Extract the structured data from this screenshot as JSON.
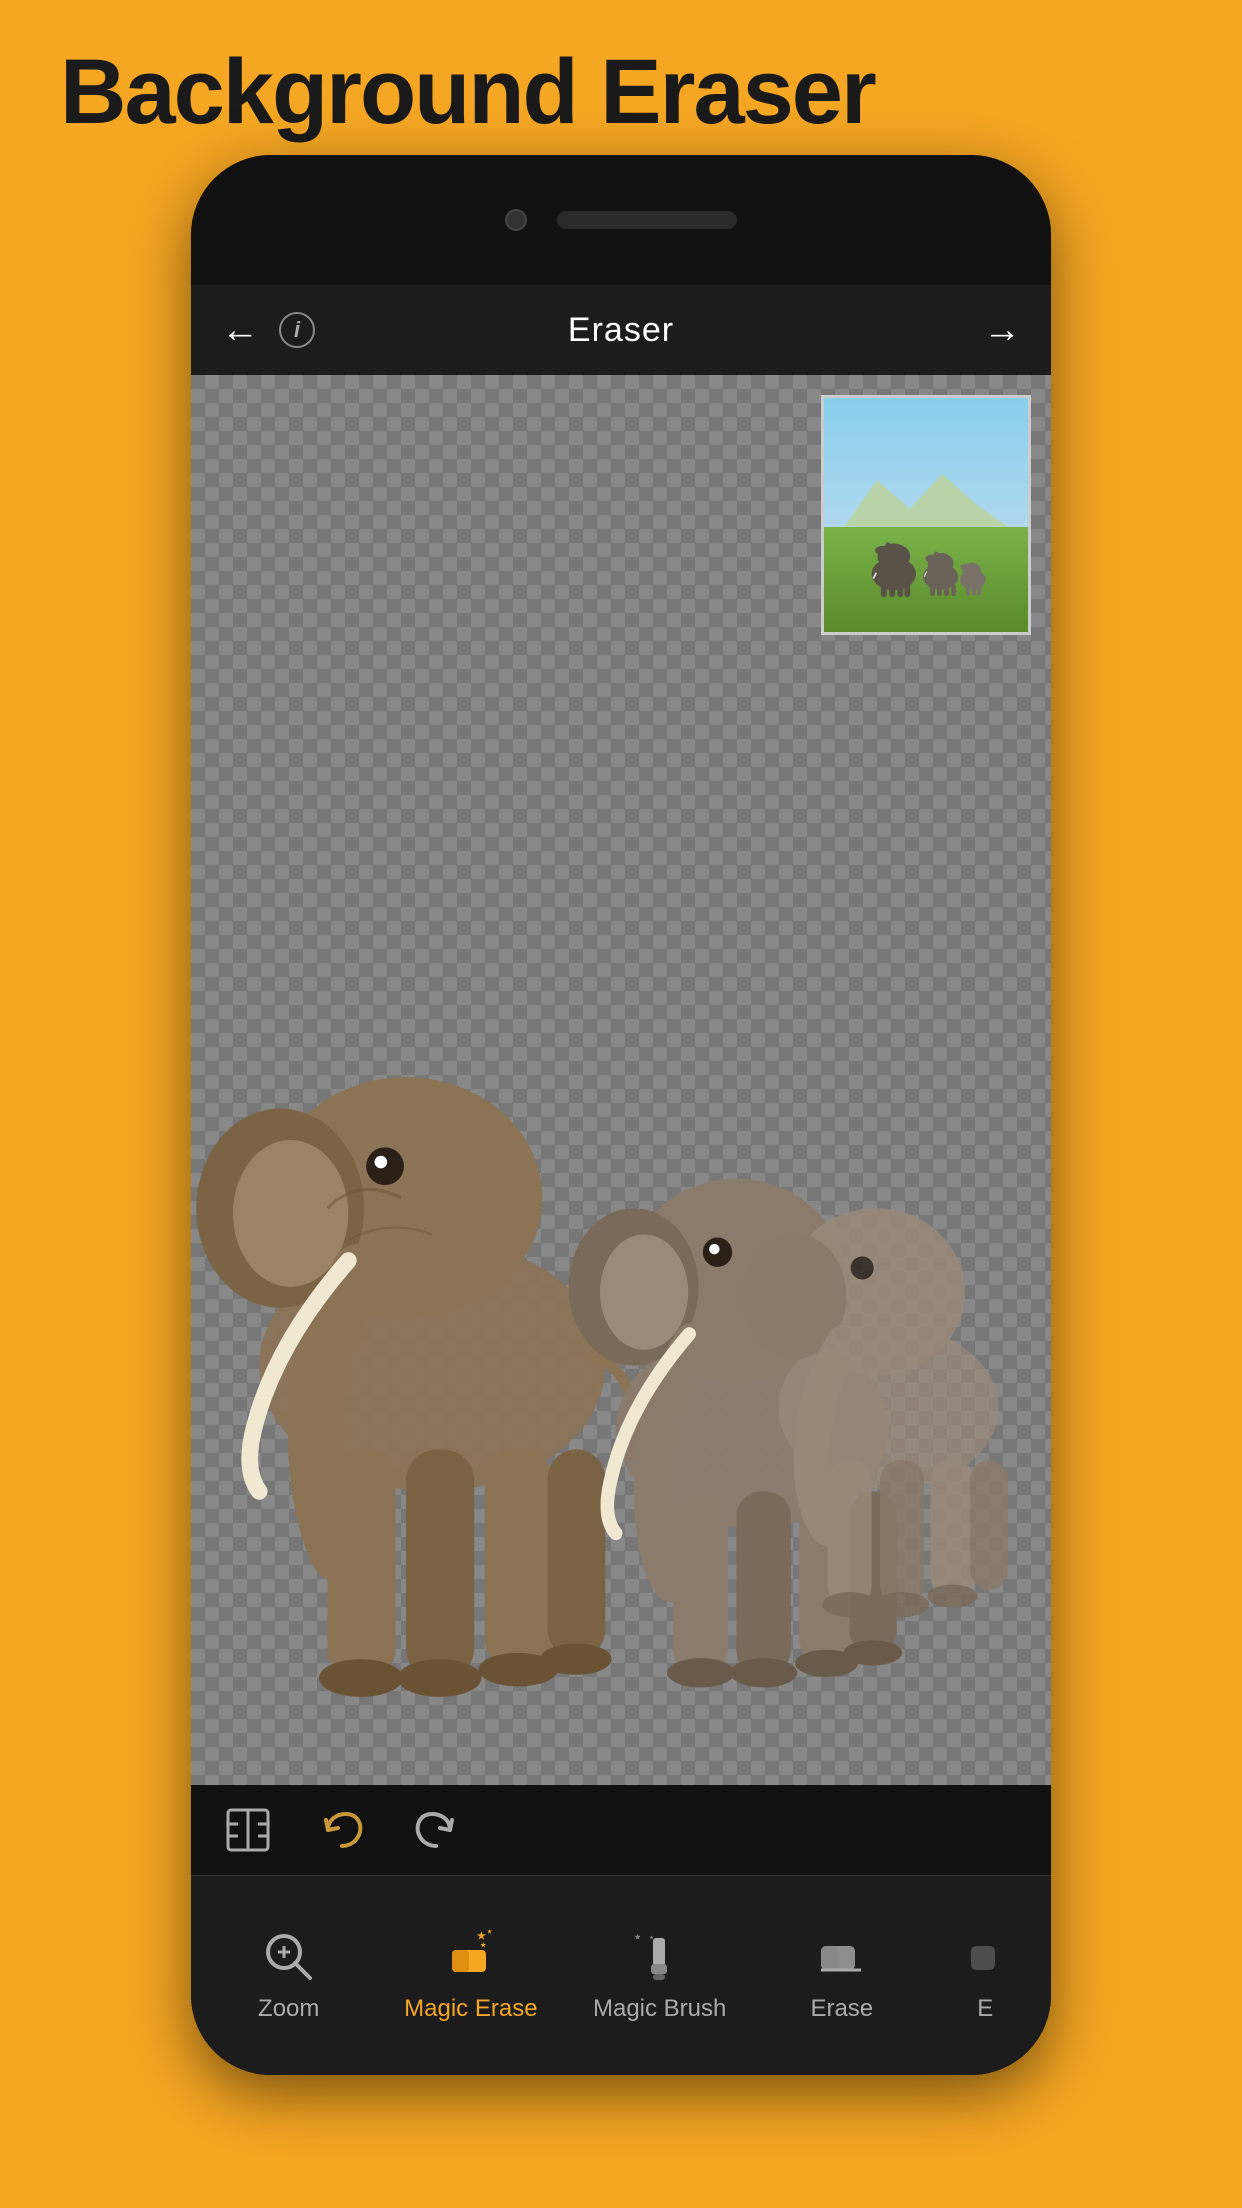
{
  "app": {
    "title": "Background Eraser",
    "nav": {
      "screen_title": "Eraser",
      "back_label": "←",
      "forward_label": "→",
      "info_label": "i"
    },
    "toolbar": {
      "items": [
        {
          "id": "zoom",
          "label": "Zoom",
          "active": false
        },
        {
          "id": "magic-erase",
          "label": "Magic Erase",
          "active": true
        },
        {
          "id": "magic-brush",
          "label": "Magic Brush",
          "active": false
        },
        {
          "id": "erase",
          "label": "Erase",
          "active": false
        },
        {
          "id": "erase2",
          "label": "E",
          "active": false,
          "partial": true
        }
      ]
    },
    "edit_controls": {
      "crop_label": "crop",
      "undo_label": "undo",
      "redo_label": "redo"
    },
    "colors": {
      "accent": "#F5A623",
      "background_orange": "#F5A623",
      "nav_dark": "#1c1c1c",
      "phone_dark": "#1a1a1a",
      "active_tool_color": "#F5A623",
      "inactive_tool_color": "#aaaaaa"
    }
  }
}
